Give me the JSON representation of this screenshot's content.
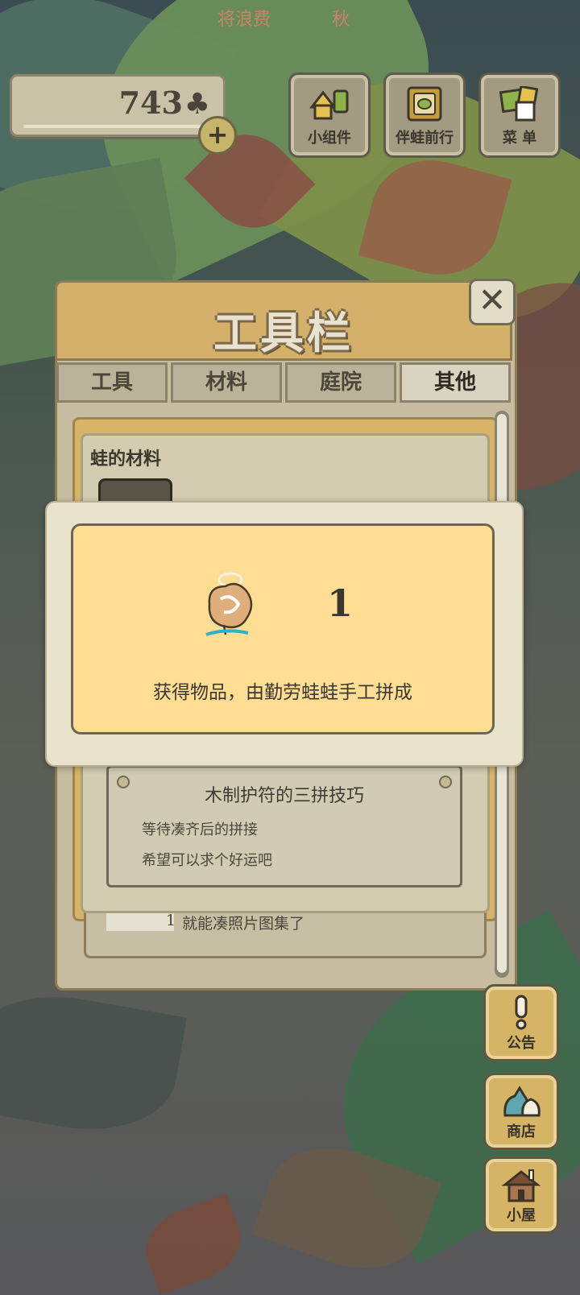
{
  "header": {
    "left_text": "将浪费",
    "season": "秋"
  },
  "currency": {
    "amount": "743",
    "icon": "clover-icon",
    "add_label": "+"
  },
  "top_buttons": [
    {
      "label": "小组件",
      "icon": "widget-icon"
    },
    {
      "label": "伴蛙前行",
      "icon": "frog-journey-icon"
    },
    {
      "label": "菜 单",
      "icon": "menu-icon"
    }
  ],
  "toolbar": {
    "title": "工具栏",
    "close_label": "✕",
    "tabs": [
      {
        "label": "工具",
        "active": false
      },
      {
        "label": "材料",
        "active": false
      },
      {
        "label": "庭院",
        "active": false
      },
      {
        "label": "其他",
        "active": true
      }
    ],
    "section_title": "蛙的材料",
    "note": {
      "title": "木制护符的三拼技巧",
      "lines": [
        "等待凑齐后的拼接",
        "希望可以求个好运吧"
      ]
    },
    "bottom": {
      "count": "1",
      "text": "就能凑照片图集了"
    }
  },
  "popup": {
    "item_icon": "wooden-charm-icon",
    "quantity": "1",
    "message": "获得物品，由勤劳蛙蛙手工拼成"
  },
  "side_buttons": [
    {
      "label": "公告",
      "icon": "exclamation-icon"
    },
    {
      "label": "商店",
      "icon": "shop-bags-icon"
    },
    {
      "label": "小屋",
      "icon": "house-icon"
    }
  ],
  "colors": {
    "panel_gold": "#d4b06a",
    "popup_fill": "#ffde94",
    "text_dark": "#3a3630"
  }
}
